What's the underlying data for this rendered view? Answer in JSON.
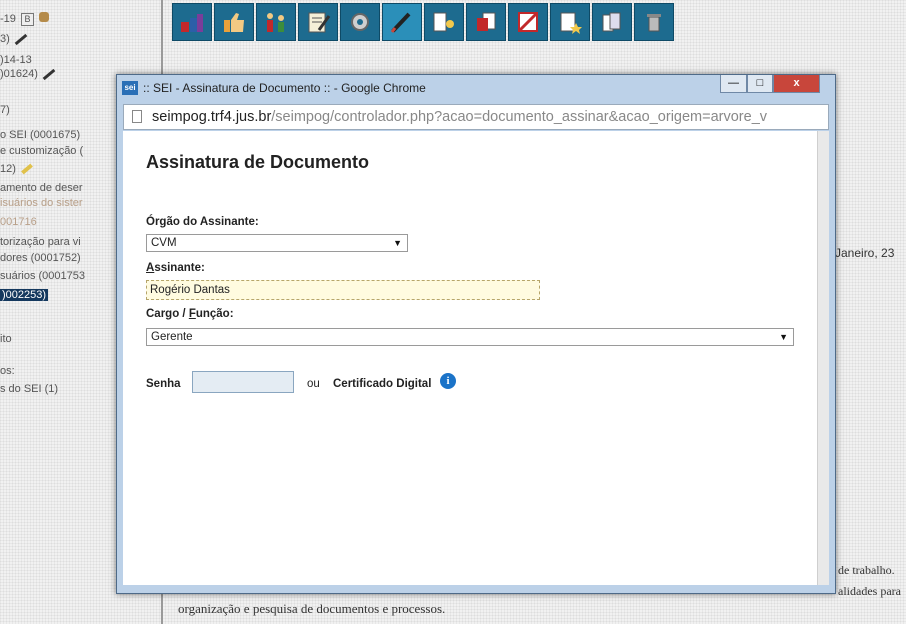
{
  "tree": {
    "lines": [
      "-19",
      "3)",
      ")14-13",
      ")01624)",
      "7)",
      "o SEI (0001675)",
      "e customização (",
      "12)",
      "amento de deser",
      "isuários do sister",
      "001716",
      "torização para vi",
      "dores (0001752)",
      "suários (0001753",
      ")002253)",
      "ito",
      "os:",
      "s do SEI (1)"
    ],
    "badge": "B"
  },
  "toolbar": {
    "icons": [
      "users-icon",
      "thumbs-up-icon",
      "family-icon",
      "edit-document-icon",
      "gear-icon",
      "pen-sign-icon",
      "document-tree-icon",
      "document-copy-icon",
      "cancel-icon",
      "new-document-icon",
      "copy-pages-icon",
      "trash-icon"
    ]
  },
  "background": {
    "janeiro": "Janeiro, 23",
    "trabalho": "de trabalho.",
    "validades": "alidades para",
    "bottom_line": "organização e pesquisa de documentos e processos."
  },
  "window": {
    "favicon": "sei",
    "title": ":: SEI - Assinatura de Documento :: - Google Chrome",
    "controls": {
      "minimize": "—",
      "maximize": "□",
      "close": "x"
    },
    "url_host": "seimpog.trf4.jus.br",
    "url_rest": "/seimpog/controlador.php?acao=documento_assinar&acao_origem=arvore_v"
  },
  "form": {
    "heading": "Assinatura de Documento",
    "orgao_label": "Órgão do Assinante:",
    "orgao_value": "CVM",
    "assinante_label_first": "A",
    "assinante_label_rest": "ssinante:",
    "assinante_value": "Rogério Dantas",
    "cargo_label_prefix": "Cargo / ",
    "cargo_label_u": "F",
    "cargo_label_rest": "unção:",
    "cargo_value": "Gerente",
    "senha_label": "Senha",
    "ou": "ou",
    "certificado": "Certificado Digital",
    "info_icon": "i",
    "select_arrow": "▼"
  },
  "colors": {
    "toolbar_bg": "#1d6b8f",
    "window_frame": "#bcd1e8",
    "close_button": "#c8463b",
    "tree_selected": "#14385e",
    "input_highlight": "#fffbe0"
  }
}
